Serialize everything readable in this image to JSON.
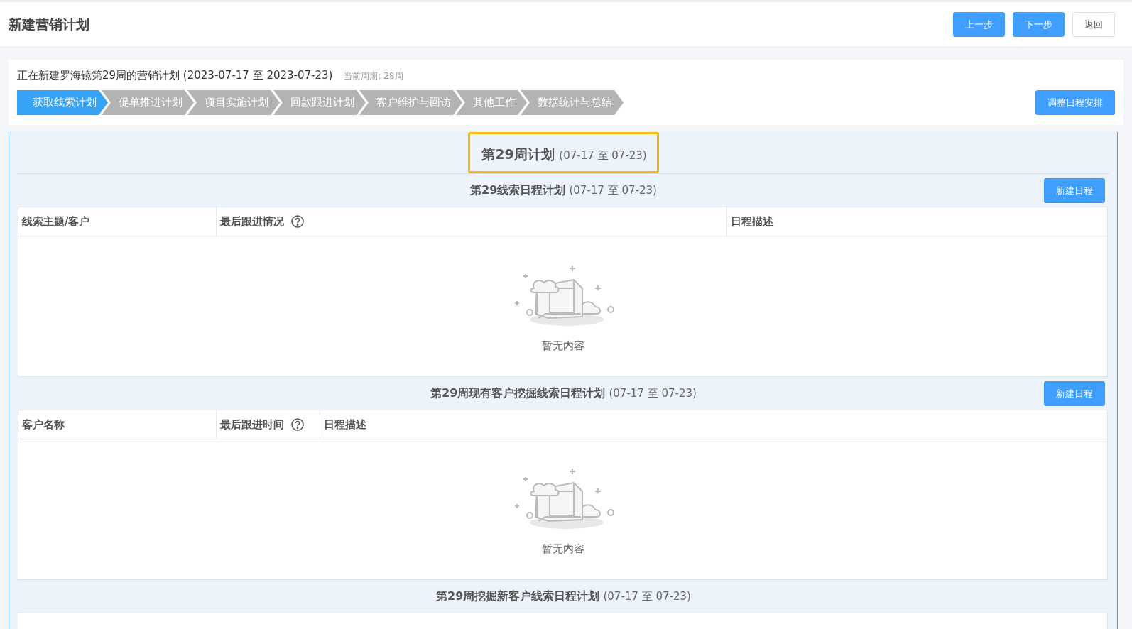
{
  "header": {
    "title": "新建营销计划",
    "buttons": [
      {
        "label": "上一步",
        "kind": "primary"
      },
      {
        "label": "下一步",
        "kind": "primary"
      },
      {
        "label": "返回",
        "kind": "default"
      }
    ]
  },
  "plan": {
    "text": "正在新建罗海镜第29周的营销计划 (2023-07-17 至 2023-07-23)",
    "period": "当前周期: 28周",
    "steps": [
      {
        "label": "获取线索计划",
        "selected": true
      },
      {
        "label": "促单推进计划",
        "selected": false
      },
      {
        "label": "项目实施计划",
        "selected": false
      },
      {
        "label": "回款跟进计划",
        "selected": false
      },
      {
        "label": "客户维护与回访",
        "selected": false
      },
      {
        "label": "其他工作",
        "selected": false
      },
      {
        "label": "数据统计与总结",
        "selected": false
      }
    ],
    "adjust_button": "调整日程安排"
  },
  "week_title": {
    "title": "第29周计划",
    "range": "(07-17 至 07-23)"
  },
  "sections": [
    {
      "title": "第29线索日程计划",
      "range": "(07-17 至 07-23)",
      "button": "新建日程",
      "columns": [
        {
          "label": "线索主题/客户",
          "help": false
        },
        {
          "label": "最后跟进情况",
          "help": true
        },
        {
          "label": "日程描述",
          "help": false
        }
      ],
      "empty_text": "暂无内容"
    },
    {
      "title": "第29周现有客户挖掘线索日程计划",
      "range": "(07-17 至 07-23)",
      "button": "新建日程",
      "columns": [
        {
          "label": "客户名称",
          "help": false
        },
        {
          "label": "最后跟进时间",
          "help": true
        },
        {
          "label": "日程描述",
          "help": false
        }
      ],
      "empty_text": "暂无内容"
    },
    {
      "title": "第29周挖掘新客户线索日程计划",
      "range": "(07-17 至 07-23)"
    }
  ]
}
